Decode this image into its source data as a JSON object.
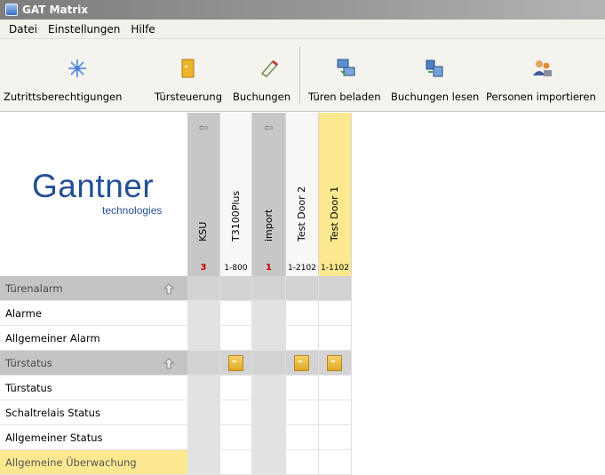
{
  "window": {
    "title": "GAT Matrix"
  },
  "menu": [
    "Datei",
    "Einstellungen",
    "Hilfe"
  ],
  "toolbar": [
    {
      "label": "Zutrittsberechtigungen",
      "icon": "access-rights-icon"
    },
    {
      "label": "Türsteuerung",
      "icon": "door-control-icon"
    },
    {
      "label": "Buchungen",
      "icon": "bookings-icon"
    },
    {
      "label": "Türen beladen",
      "icon": "load-doors-icon"
    },
    {
      "label": "Buchungen lesen",
      "icon": "read-bookings-icon"
    },
    {
      "label": "Personen importieren",
      "icon": "import-persons-icon"
    }
  ],
  "logo": {
    "main": "Gantner",
    "sub": "technologies"
  },
  "columns": [
    {
      "name": "KSU",
      "id": "3",
      "style": "gray",
      "arrow": true
    },
    {
      "name": "T3100Plus",
      "id": "1-800",
      "style": "white",
      "arrow": false
    },
    {
      "name": "import",
      "id": "1",
      "style": "gray",
      "arrow": true
    },
    {
      "name": "Test Door 2",
      "id": "1-2102",
      "style": "white",
      "arrow": false
    },
    {
      "name": "Test Door 1",
      "id": "1-1102",
      "style": "yellow",
      "arrow": false
    }
  ],
  "rows": [
    {
      "label": "Türenalarm",
      "type": "group",
      "doors": [
        false,
        false,
        false,
        false,
        false
      ]
    },
    {
      "label": "Alarme",
      "type": "item",
      "doors": [
        false,
        false,
        false,
        false,
        false
      ]
    },
    {
      "label": "Allgemeiner Alarm",
      "type": "item",
      "doors": [
        false,
        false,
        false,
        false,
        false
      ]
    },
    {
      "label": "Türstatus",
      "type": "group",
      "doors": [
        false,
        true,
        false,
        true,
        true
      ]
    },
    {
      "label": "Türstatus",
      "type": "item",
      "doors": [
        false,
        false,
        false,
        false,
        false
      ]
    },
    {
      "label": "Schaltrelais Status",
      "type": "item",
      "doors": [
        false,
        false,
        false,
        false,
        false
      ]
    },
    {
      "label": "Allgemeiner Status",
      "type": "item",
      "doors": [
        false,
        false,
        false,
        false,
        false
      ]
    },
    {
      "label": "Allgemeine Überwachung",
      "type": "highlight",
      "doors": [
        false,
        false,
        false,
        false,
        false
      ]
    }
  ],
  "colors": {
    "accent_yellow": "#fbe88f",
    "logo_blue": "#244f93",
    "id_red": "#c00000"
  }
}
